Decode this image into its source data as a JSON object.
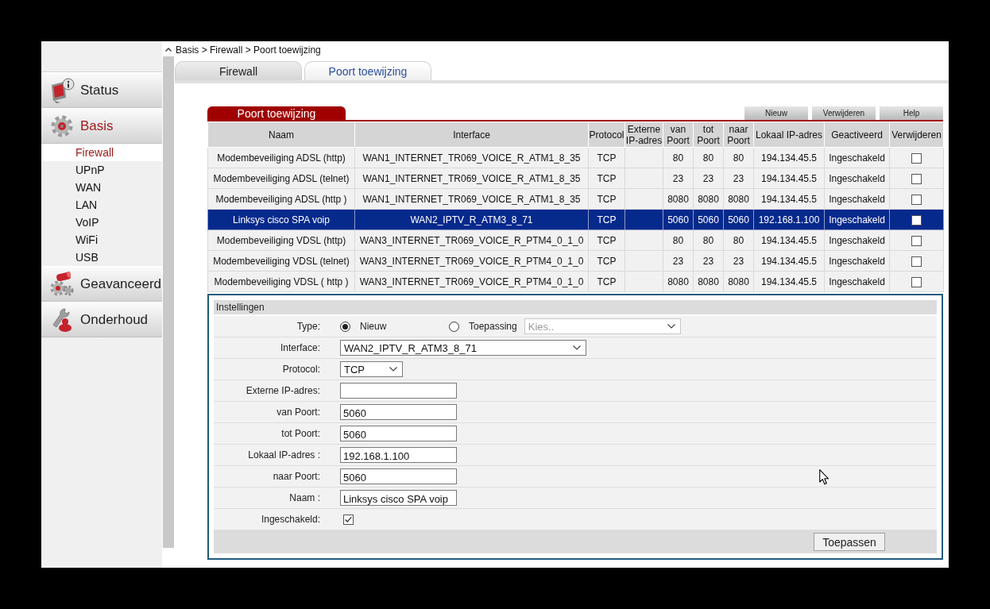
{
  "breadcrumb": "Basis > Firewall > Poort toewijzing",
  "sidebar": {
    "items": [
      {
        "label": "Status",
        "selected": false
      },
      {
        "label": "Basis",
        "selected": true,
        "children": [
          {
            "label": "Firewall",
            "selected": true
          },
          {
            "label": "UPnP",
            "selected": false
          },
          {
            "label": "WAN",
            "selected": false
          },
          {
            "label": "LAN",
            "selected": false
          },
          {
            "label": "VoIP",
            "selected": false
          },
          {
            "label": "WiFi",
            "selected": false
          },
          {
            "label": "USB",
            "selected": false
          }
        ]
      },
      {
        "label": "Geavanceerd",
        "selected": false
      },
      {
        "label": "Onderhoud",
        "selected": false
      }
    ]
  },
  "tabs": [
    {
      "label": "Firewall",
      "selected": false
    },
    {
      "label": "Poort toewijzing",
      "selected": true
    }
  ],
  "panel": {
    "title": "Poort toewijzing",
    "buttons": [
      "Nieuw",
      "Verwijderen",
      "Help"
    ]
  },
  "table": {
    "columns": [
      "Naam",
      "Interface",
      "Protocol",
      "Externe IP-adres",
      "van Poort",
      "tot Poort",
      "naar Poort",
      "Lokaal IP-adres",
      "Geactiveerd",
      "Verwijderen"
    ],
    "rows": [
      {
        "naam": "Modembeveiliging ADSL (http)",
        "interface": "WAN1_INTERNET_TR069_VOICE_R_ATM1_8_35",
        "protocol": "TCP",
        "van_poort": "80",
        "tot_poort": "80",
        "naar_poort": "80",
        "lokaal_ip_adres": "194.134.45.5",
        "geactiveerd": "Ingeschakeld",
        "checked": false,
        "selected": false
      },
      {
        "naam": "Modembeveiliging ADSL (telnet)",
        "interface": "WAN1_INTERNET_TR069_VOICE_R_ATM1_8_35",
        "protocol": "TCP",
        "van_poort": "23",
        "tot_poort": "23",
        "naar_poort": "23",
        "lokaal_ip_adres": "194.134.45.5",
        "geactiveerd": "Ingeschakeld",
        "checked": false,
        "selected": false
      },
      {
        "naam": "Modembeveiliging ADSL (http )",
        "interface": "WAN1_INTERNET_TR069_VOICE_R_ATM1_8_35",
        "protocol": "TCP",
        "van_poort": "8080",
        "tot_poort": "8080",
        "naar_poort": "8080",
        "lokaal_ip_adres": "194.134.45.5",
        "geactiveerd": "Ingeschakeld",
        "checked": false,
        "selected": false
      },
      {
        "naam": "Linksys cisco SPA voip",
        "interface": "WAN2_IPTV_R_ATM3_8_71",
        "protocol": "TCP",
        "van_poort": "5060",
        "tot_poort": "5060",
        "naar_poort": "5060",
        "lokaal_ip_adres": "192.168.1.100",
        "geactiveerd": "Ingeschakeld",
        "checked": false,
        "selected": true
      },
      {
        "naam": "Modembeveiliging VDSL (http)",
        "interface": "WAN3_INTERNET_TR069_VOICE_R_PTM4_0_1_0",
        "protocol": "TCP",
        "van_poort": "80",
        "tot_poort": "80",
        "naar_poort": "80",
        "lokaal_ip_adres": "194.134.45.5",
        "geactiveerd": "Ingeschakeld",
        "checked": false,
        "selected": false
      },
      {
        "naam": "Modembeveiliging VDSL (telnet)",
        "interface": "WAN3_INTERNET_TR069_VOICE_R_PTM4_0_1_0",
        "protocol": "TCP",
        "van_poort": "23",
        "tot_poort": "23",
        "naar_poort": "23",
        "lokaal_ip_adres": "194.134.45.5",
        "geactiveerd": "Ingeschakeld",
        "checked": false,
        "selected": false
      },
      {
        "naam": "Modembeveiliging VDSL ( http )",
        "interface": "WAN3_INTERNET_TR069_VOICE_R_PTM4_0_1_0",
        "protocol": "TCP",
        "van_poort": "8080",
        "tot_poort": "8080",
        "naar_poort": "8080",
        "lokaal_ip_adres": "194.134.45.5",
        "geactiveerd": "Ingeschakeld",
        "checked": false,
        "selected": false
      }
    ]
  },
  "settings": {
    "title": "Instellingen",
    "rows": [
      {
        "kind": "type",
        "label": "Type:",
        "options": [
          {
            "label": "Nieuw",
            "selected": true
          },
          {
            "label": "Toepassing",
            "selected": false
          }
        ],
        "select": {
          "value": "Kies..",
          "disabled": true
        }
      },
      {
        "kind": "select",
        "label": "Interface:",
        "value": "WAN2_IPTV_R_ATM3_8_71"
      },
      {
        "kind": "select",
        "label": "Protocol:",
        "value": "TCP"
      },
      {
        "kind": "text",
        "label": "Externe IP-adres:"
      },
      {
        "kind": "text",
        "label": "van Poort:",
        "value": "5060"
      },
      {
        "kind": "text",
        "label": "tot Poort:",
        "value": "5060"
      },
      {
        "kind": "text",
        "label": "Lokaal IP-adres :",
        "value": "192.168.1.100"
      },
      {
        "kind": "text",
        "label": "naar Poort:",
        "value": "5060"
      },
      {
        "kind": "text",
        "label": "Naam :",
        "value": "Linksys cisco SPA voip"
      },
      {
        "kind": "checkbox",
        "label": "Ingeschakeld:",
        "checked": true
      }
    ],
    "apply_button": "Toepassen"
  }
}
